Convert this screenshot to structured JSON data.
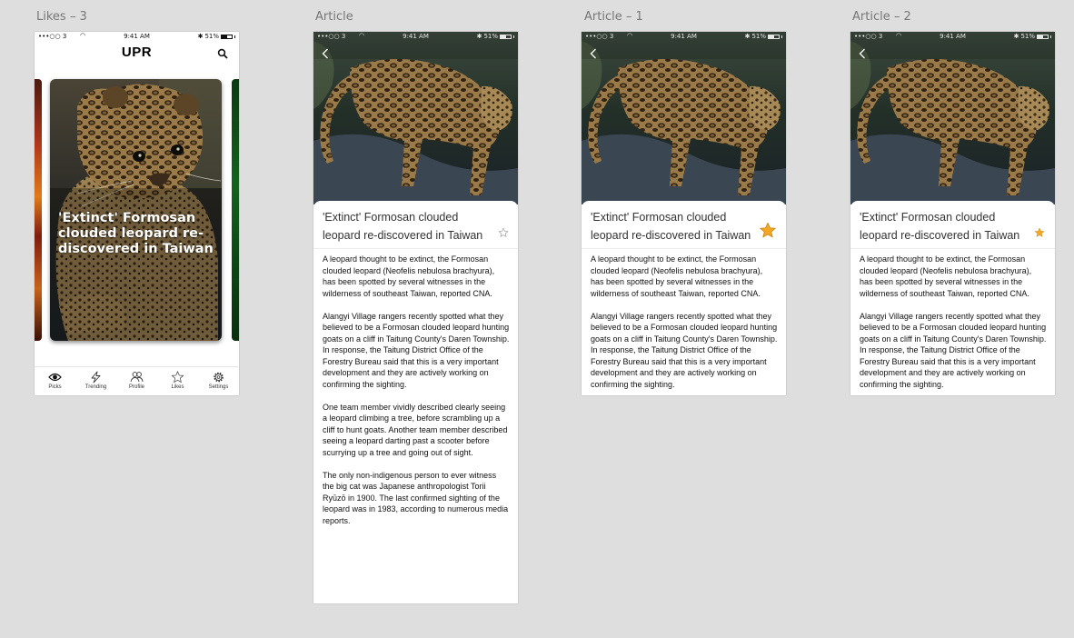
{
  "artboards": {
    "likes": "Likes – 3",
    "article": "Article",
    "article1": "Article – 1",
    "article2": "Article – 2"
  },
  "status_bar": {
    "carrier": "•••○○ 3",
    "wifi_icon": "wifi-icon",
    "time": "9:41 AM",
    "battery": "51%",
    "bluetooth": "✱"
  },
  "likes_screen": {
    "app_title": "UPR",
    "search_icon": "search-icon",
    "card_headline": "'Extinct' Formosan clouded leopard re-discovered in Taiwan",
    "tabs": [
      {
        "label": "Picks",
        "icon": "eye-icon"
      },
      {
        "label": "Trending",
        "icon": "lightning-icon"
      },
      {
        "label": "Profile",
        "icon": "people-icon"
      },
      {
        "label": "Likes",
        "icon": "star-icon"
      },
      {
        "label": "Settings",
        "icon": "gear-icon"
      }
    ]
  },
  "article": {
    "headline": "'Extinct' Formosan clouded leopard re-discovered in Taiwan",
    "paragraphs": [
      "A leopard thought to be extinct, the Formosan clouded leopard (Neofelis nebulosa brachyura), has been spotted by several witnesses in the wilderness of southeast Taiwan, reported CNA.",
      "Alangyi Village rangers recently spotted what they believed to be a Formosan clouded leopard hunting goats on a cliff in Taitung County's Daren Township. In response, the Taitung District Office of the Forestry Bureau said that this is a very important development and they are actively working on confirming the sighting.",
      "One team member vividly described clearly seeing a leopard climbing a tree, before scrambling up a cliff to hunt goats. Another team member described seeing a leopard darting past a scooter before scurrying up a tree and going out of sight.",
      "The only non-indigenous person to ever witness the big cat was Japanese anthropologist Torii Ryūzō in 1900. The last confirmed sighting of the leopard was in 1983, according to numerous media reports."
    ],
    "star_colors": {
      "outline": "#9a9a9a",
      "filled": "#f5a623",
      "stroke": "#c98412"
    }
  }
}
